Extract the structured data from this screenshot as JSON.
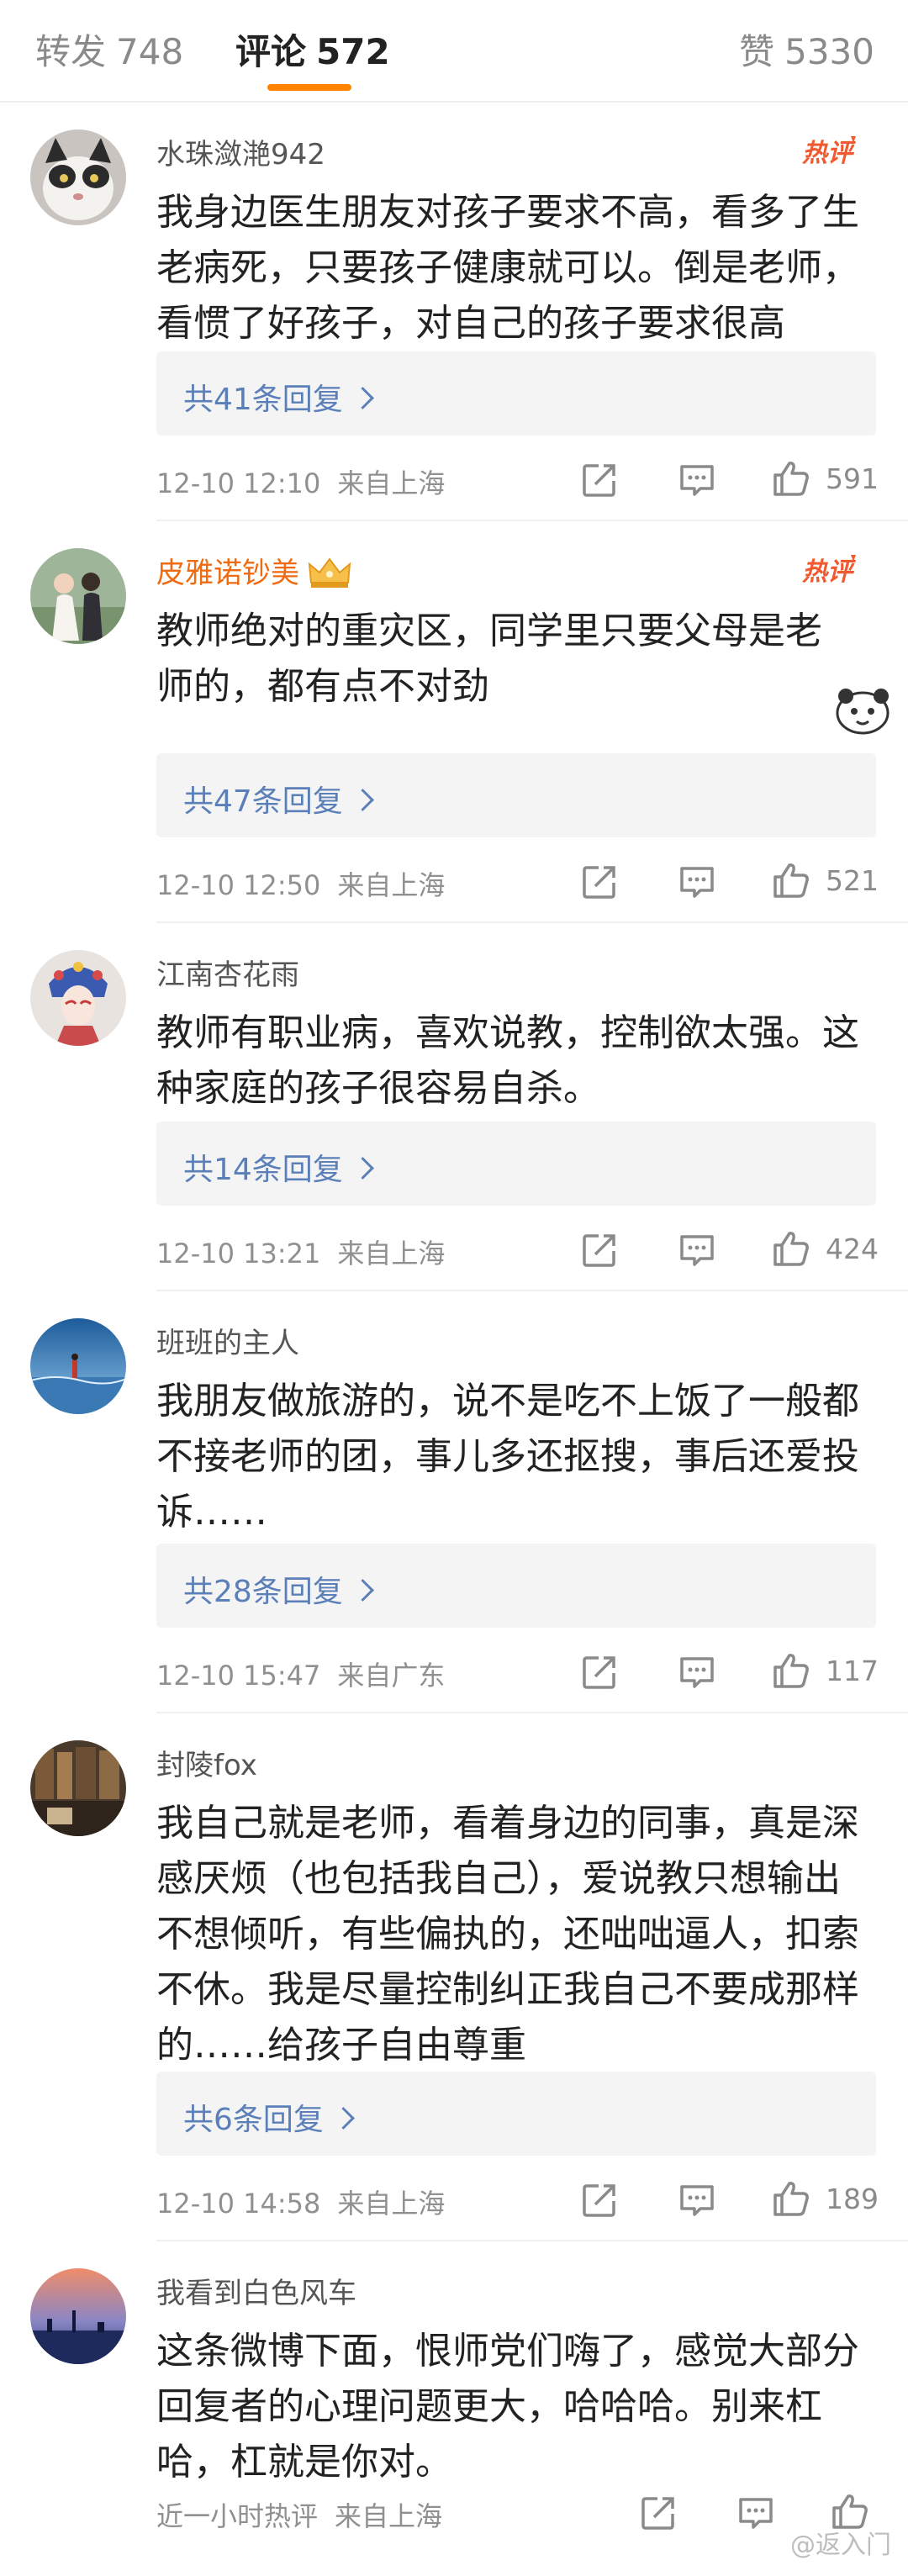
{
  "tabs": {
    "repost": {
      "label": "转发",
      "count": "748"
    },
    "comments": {
      "label": "评论",
      "count": "572"
    },
    "likes": {
      "label": "赞",
      "count": "5330"
    }
  },
  "hot_badge_label": "热评",
  "accent_color": "#ff8200",
  "link_color": "#5b7fb8",
  "comments": [
    {
      "username": "水珠潋滟942",
      "vip": false,
      "hot": true,
      "text_lines": [
        "我身边医生朋友对孩子要求不高，看多了生",
        "老病死，只要孩子健康就可以。倒是老师，",
        "看惯了好孩子，对自己的孩子要求很高"
      ],
      "replies": "共41条回复",
      "time": "12-10 12:10",
      "location": "来自上海",
      "likes": "591"
    },
    {
      "username": "皮雅诺钞美",
      "vip": true,
      "hot": true,
      "text_lines": [
        "教师绝对的重灾区，同学里只要父母是老",
        "师的，都有点不对劲"
      ],
      "replies": "共47条回复",
      "time": "12-10 12:50",
      "location": "来自上海",
      "likes": "521"
    },
    {
      "username": "江南杏花雨",
      "vip": false,
      "hot": false,
      "text_lines": [
        "教师有职业病，喜欢说教，控制欲太强。这",
        "种家庭的孩子很容易自杀。"
      ],
      "replies": "共14条回复",
      "time": "12-10 13:21",
      "location": "来自上海",
      "likes": "424"
    },
    {
      "username": "班班的主人",
      "vip": false,
      "hot": false,
      "text_lines": [
        "我朋友做旅游的，说不是吃不上饭了一般都",
        "不接老师的团，事儿多还抠搜，事后还爱投",
        "诉……"
      ],
      "replies": "共28条回复",
      "time": "12-10 15:47",
      "location": "来自广东",
      "likes": "117"
    },
    {
      "username": "封陵fox",
      "vip": false,
      "hot": false,
      "text_lines": [
        "我自己就是老师，看着身边的同事，真是深",
        "感厌烦（也包括我自己），爱说教只想输出",
        "不想倾听，有些偏执的，还咄咄逼人，扣索",
        "不休。我是尽量控制纠正我自己不要成那样",
        "的……给孩子自由尊重"
      ],
      "replies": "共6条回复",
      "time": "12-10 14:58",
      "location": "来自上海",
      "likes": "189"
    },
    {
      "username": "我看到白色风车",
      "vip": false,
      "hot": false,
      "text_lines": [
        "这条微博下面，恨师党们嗨了，感觉大部分",
        "回复者的心理问题更大，哈哈哈。别来杠",
        "哈，杠就是你对。"
      ],
      "time": "近一小时热评",
      "location": "来自上海"
    }
  ],
  "watermark": "@返入门",
  "icons": [
    "share-icon",
    "comment-icon",
    "like-icon",
    "chevron-right-icon",
    "crown-icon",
    "hot-badge"
  ]
}
